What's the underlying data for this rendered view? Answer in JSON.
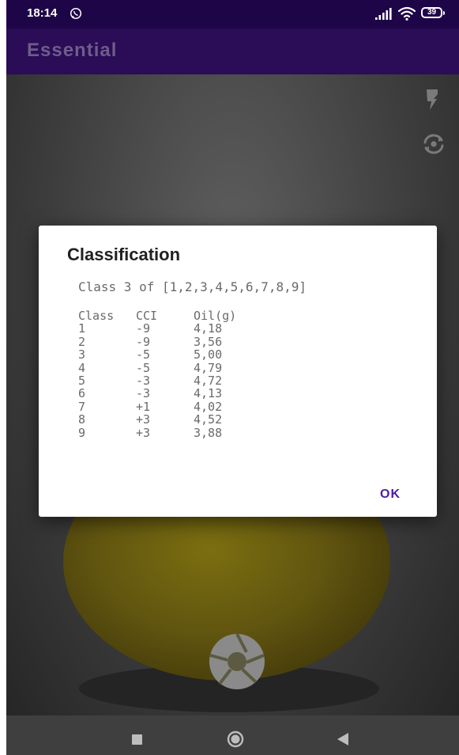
{
  "status_bar": {
    "time": "18:14",
    "battery": "39",
    "icons": [
      "whatsapp-icon",
      "signal-icon",
      "wifi-icon",
      "battery-icon"
    ]
  },
  "app_bar": {
    "title": "Essential"
  },
  "camera": {
    "icons": [
      "flash-icon",
      "switch-camera-icon",
      "shutter-icon"
    ]
  },
  "dialog": {
    "title": "Classification",
    "summary": "Class 3 of [1,2,3,4,5,6,7,8,9]",
    "table": {
      "headers": [
        "Class",
        "CCI",
        "Oil(g)"
      ],
      "rows": [
        [
          "1",
          "-9",
          "4,18"
        ],
        [
          "2",
          "-9",
          "3,56"
        ],
        [
          "3",
          "-5",
          "5,00"
        ],
        [
          "4",
          "-5",
          "4,79"
        ],
        [
          "5",
          "-3",
          "4,72"
        ],
        [
          "6",
          "-3",
          "4,13"
        ],
        [
          "7",
          "+1",
          "4,02"
        ],
        [
          "8",
          "+3",
          "4,52"
        ],
        [
          "9",
          "+3",
          "3,88"
        ]
      ]
    },
    "ok_label": "OK"
  },
  "nav_bar": {
    "icons": [
      "recents-icon",
      "home-icon",
      "back-icon"
    ]
  },
  "colors": {
    "status_bar": "#1e0547",
    "app_bar": "#2a0c57",
    "accent": "#4b1aa8",
    "nav_bar": "#3f3f3f"
  }
}
